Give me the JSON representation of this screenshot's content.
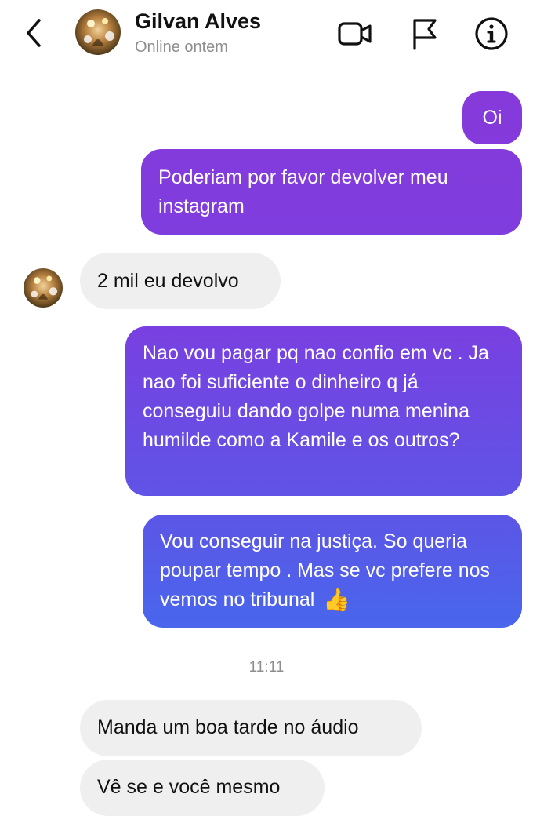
{
  "header": {
    "contact_name": "Gilvan Alves",
    "status": "Online ontem",
    "icons": [
      "back-chevron-icon",
      "video-call-icon",
      "report-flag-icon",
      "info-icon"
    ]
  },
  "messages": [
    {
      "from": "me",
      "text": "Oi"
    },
    {
      "from": "me",
      "text": "Poderiam por favor devolver meu instagram"
    },
    {
      "from": "contact",
      "text": "2 mil eu devolvo"
    },
    {
      "from": "me",
      "text": "Nao vou pagar pq nao confio em vc . Ja nao foi suficiente o dinheiro q já conseguiu dando golpe numa menina humilde como a Kamile e os outros?"
    },
    {
      "from": "me",
      "text": "Vou conseguir na justiça. So queria poupar tempo . Mas se vc prefere nos vemos no tribunal",
      "emoji": "👍"
    },
    {
      "from": "contact",
      "text": "Manda um boa tarde no áudio"
    },
    {
      "from": "contact",
      "text": "Vê se e você mesmo"
    }
  ],
  "timestamp": "11:11",
  "colors": {
    "outgoing_gradient_top": "#8b37d8",
    "outgoing_gradient_bottom": "#3a72f2",
    "incoming_bubble": "#efefef",
    "secondary_text": "#8e8e8e"
  }
}
